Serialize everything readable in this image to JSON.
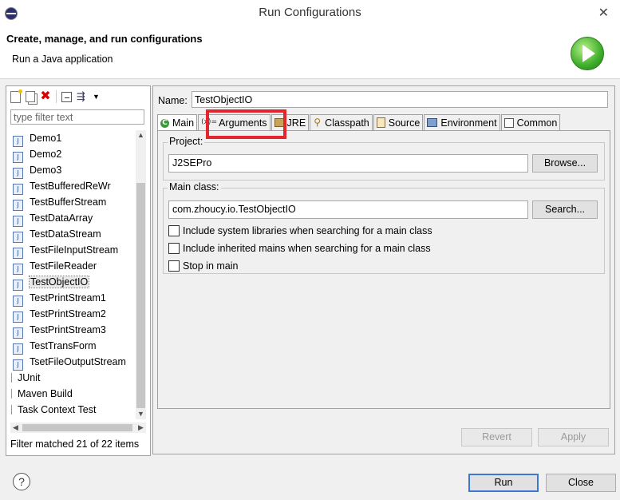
{
  "window": {
    "title": "Run Configurations",
    "close_glyph": "✕",
    "app_icon": "eclipse-icon"
  },
  "banner": {
    "heading": "Create, manage, and run configurations",
    "subtitle": "Run a Java application",
    "image": "run-icon"
  },
  "left": {
    "filter_placeholder": "type filter text",
    "items": [
      {
        "label": "Demo1",
        "kind": "java"
      },
      {
        "label": "Demo2",
        "kind": "java"
      },
      {
        "label": "Demo3",
        "kind": "java"
      },
      {
        "label": "TestBufferedReWr",
        "kind": "java"
      },
      {
        "label": "TestBufferStream",
        "kind": "java"
      },
      {
        "label": "TestDataArray",
        "kind": "java"
      },
      {
        "label": "TestDataStream",
        "kind": "java"
      },
      {
        "label": "TestFileInputStream",
        "kind": "java"
      },
      {
        "label": "TestFileReader",
        "kind": "java"
      },
      {
        "label": "TestObjectIO",
        "kind": "java",
        "selected": true
      },
      {
        "label": "TestPrintStream1",
        "kind": "java"
      },
      {
        "label": "TestPrintStream2",
        "kind": "java"
      },
      {
        "label": "TestPrintStream3",
        "kind": "java"
      },
      {
        "label": "TestTransForm",
        "kind": "java"
      },
      {
        "label": "TsetFileOutputStream",
        "kind": "java"
      },
      {
        "label": "JUnit",
        "kind": "group"
      },
      {
        "label": "Maven Build",
        "kind": "group"
      },
      {
        "label": "Task Context Test",
        "kind": "group"
      }
    ],
    "status": "Filter matched 21 of 22 items"
  },
  "right": {
    "name_label": "Name:",
    "name_value": "TestObjectIO",
    "tabs": [
      {
        "label": "Main",
        "icon": "main-tab-icon",
        "active": true
      },
      {
        "label": "Arguments",
        "icon": "arguments-tab-icon",
        "active": false
      },
      {
        "label": "JRE",
        "icon": "jre-tab-icon",
        "active": false
      },
      {
        "label": "Classpath",
        "icon": "classpath-tab-icon",
        "active": false
      },
      {
        "label": "Source",
        "icon": "source-tab-icon",
        "active": false
      },
      {
        "label": "Environment",
        "icon": "environment-tab-icon",
        "active": false
      },
      {
        "label": "Common",
        "icon": "common-tab-icon",
        "active": false
      }
    ],
    "project": {
      "label": "Project:",
      "value": "J2SEPro",
      "button": "Browse..."
    },
    "main_class": {
      "label": "Main class:",
      "value": "com.zhoucy.io.TestObjectIO",
      "button": "Search..."
    },
    "options": [
      {
        "label": "Include system libraries when searching for a main class",
        "checked": false
      },
      {
        "label": "Include inherited mains when searching for a main class",
        "checked": false
      },
      {
        "label": "Stop in main",
        "checked": false
      }
    ],
    "revert": "Revert",
    "apply": "Apply"
  },
  "footer": {
    "help": "?",
    "run": "Run",
    "close": "Close"
  },
  "colors": {
    "highlight_box": "#e2262c",
    "default_button_border": "#3a78d4"
  },
  "icons": {
    "toolbar": [
      "new-config-icon",
      "duplicate-icon",
      "delete-icon",
      "collapse-all-icon",
      "filter-icon",
      "dropdown-arrow-icon"
    ]
  }
}
